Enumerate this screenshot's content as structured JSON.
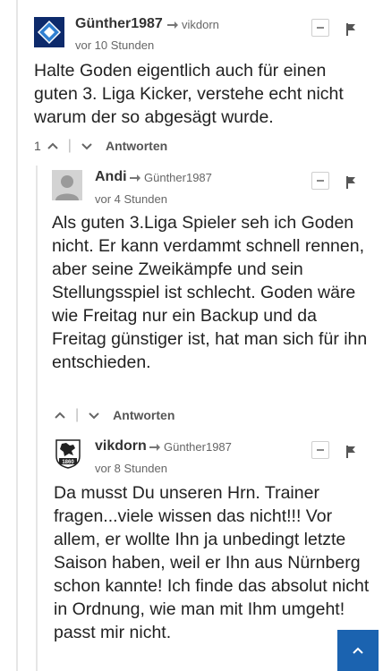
{
  "comments": [
    {
      "author": "Günther1987",
      "reply_to": "vikdorn",
      "time": "vor 10 Stunden",
      "text": "Halte Goden eigentlich auch für einen guten 3. Liga Kicker, verstehe echt nicht warum der so abgesägt wurde.",
      "votes": "1",
      "reply_label": "Antworten",
      "avatar": "club-crest-blue-diamond-icon"
    },
    {
      "author": "Andi",
      "reply_to": "Günther1987",
      "time": "vor 4 Stunden",
      "text": "Als guten 3.Liga Spieler seh ich Goden nicht. Er kann verdammt schnell rennen, aber seine Zweikämpfe und sein Stellungsspiel ist schlecht. Goden wäre wie Freitag nur ein Backup und da Freitag günstiger ist, hat man sich für ihn entschieden.",
      "votes": "",
      "reply_label": "Antworten",
      "avatar": "default-user-avatar-icon"
    },
    {
      "author": "vikdorn",
      "reply_to": "Günther1987",
      "time": "vor 8 Stunden",
      "text": "Da musst Du unseren Hrn. Trainer fragen...viele wissen das nicht!!! Vor allem, er wollte Ihn ja unbedingt letzte Saison haben, weil er Ihn aus Nürnberg schon kannte! Ich finde das absolut nicht in Ordnung, wie man mit Ihm umgeht! passt mir nicht.",
      "avatar": "1860-lion-crest-icon"
    }
  ],
  "colors": {
    "accent": "#1b63b0",
    "thread_line": "#e6e6e6",
    "meta_text": "#666666"
  }
}
